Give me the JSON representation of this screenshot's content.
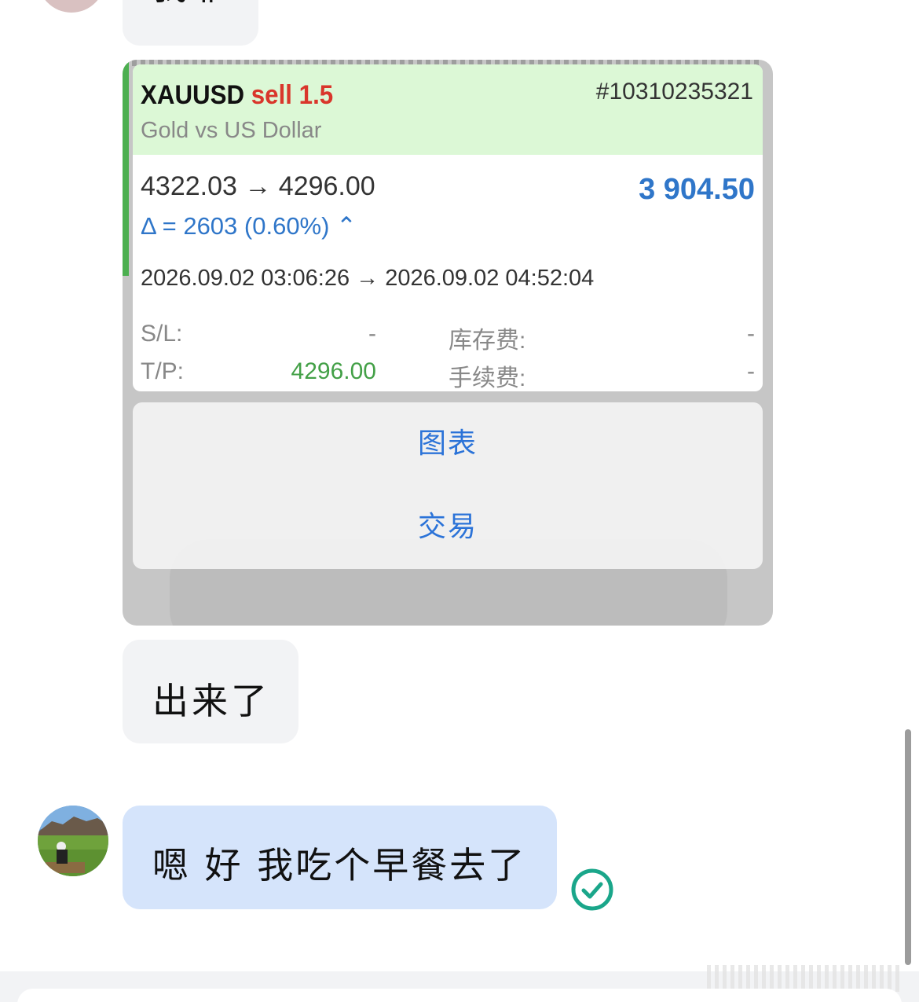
{
  "chat": {
    "top_message": "我靠",
    "out_message": "出来了",
    "my_message": "嗯 好 我吃个早餐去了"
  },
  "trade": {
    "symbol": "XAUUSD",
    "side": "sell",
    "volume": "1.5",
    "ticket": "#10310235321",
    "description": "Gold vs US Dollar",
    "prices": "4322.03 → 4296.00",
    "profit": "3 904.50",
    "delta": "Δ = 2603 (0.60%) ⌃",
    "times": "2026.09.02 03:06:26 → 2026.09.02 04:52:04",
    "sl_label": "S/L:",
    "sl_value": "-",
    "tp_label": "T/P:",
    "tp_value": "4296.00",
    "swap_label": "库存费:",
    "swap_value": "-",
    "commission_label": "手续费:",
    "commission_value": "-"
  },
  "action_sheet": {
    "chart_label": "图表",
    "trade_label": "交易"
  },
  "colors": {
    "sell": "#d9362b",
    "profit": "#2f76c9",
    "tp": "#43a047",
    "my_bubble": "#d5e4fb",
    "read_check": "#1aa68a"
  },
  "icons": {
    "read_status": "check-circle-icon"
  }
}
